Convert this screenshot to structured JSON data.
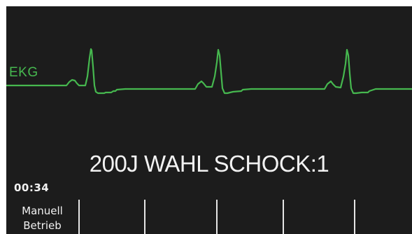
{
  "monitor": {
    "trace_label": "EKG",
    "trace_color": "#46b84f",
    "background_color": "#1c1c1c",
    "message": "200J WAHL SCHOCK:1",
    "timer": "00:34"
  },
  "softkeys": [
    {
      "line1": "Manuell",
      "line2": "Betrieb"
    },
    {
      "line1": "",
      "line2": ""
    },
    {
      "line1": "",
      "line2": ""
    },
    {
      "line1": "",
      "line2": ""
    },
    {
      "line1": "",
      "line2": ""
    },
    {
      "line1": "",
      "line2": ""
    }
  ]
}
